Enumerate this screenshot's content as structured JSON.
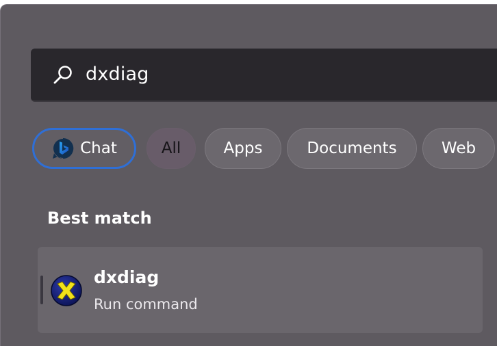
{
  "search": {
    "query": "dxdiag",
    "icon": "search-icon"
  },
  "filters": {
    "chat": {
      "label": "Chat",
      "icon": "bing-chat-icon",
      "accent_color": "#2f6fd6"
    },
    "all": {
      "label": "All"
    },
    "apps": {
      "label": "Apps"
    },
    "documents": {
      "label": "Documents"
    },
    "web": {
      "label": "Web"
    }
  },
  "best_match": {
    "heading": "Best match",
    "result": {
      "title": "dxdiag",
      "subtitle": "Run command",
      "icon": "directx-icon"
    }
  }
}
